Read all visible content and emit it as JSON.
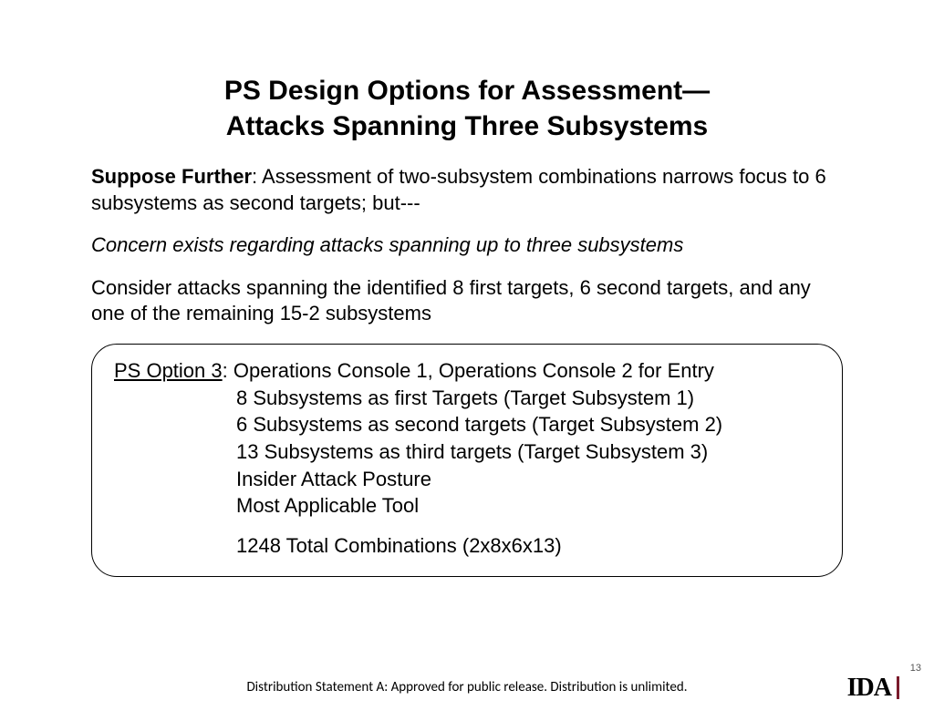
{
  "title": {
    "line1": "PS Design Options for Assessment—",
    "line2": "Attacks Spanning Three Subsystems"
  },
  "p1": {
    "lead": "Suppose Further",
    "rest": ": Assessment of two-subsystem combinations narrows focus to 6 subsystems as second targets; but---"
  },
  "p2": "Concern exists regarding attacks spanning up to three subsystems",
  "p3": "Consider attacks spanning the identified 8 first targets, 6 second targets, and any one of the remaining 15-2 subsystems",
  "option": {
    "label": "PS Option 3",
    "line1_rest": ":  Operations Console 1, Operations Console 2 for Entry",
    "line2": " 8 Subsystems as first Targets (Target Subsystem 1)",
    "line3": " 6 Subsystems as second targets (Target Subsystem 2)",
    "line4": "13 Subsystems as third targets (Target Subsystem 3)",
    "line5": "Insider Attack Posture",
    "line6": " Most Applicable Tool",
    "total": "1248 Total Combinations (2x8x6x13)"
  },
  "footer": "Distribution Statement A:  Approved for public release.  Distribution is unlimited.",
  "logo": "IDA",
  "page": "13"
}
